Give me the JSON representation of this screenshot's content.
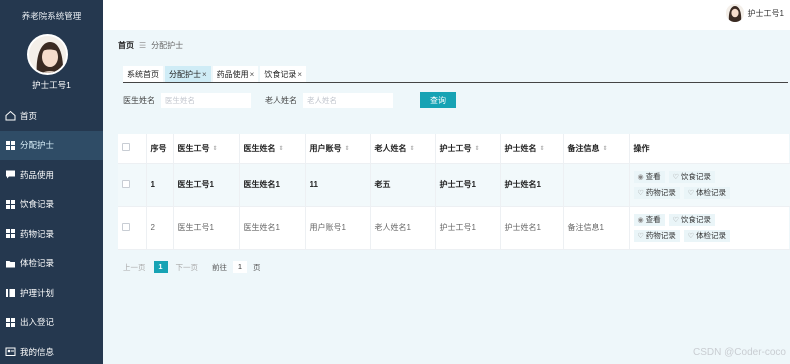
{
  "sidebar": {
    "system_title": "养老院系统管理",
    "user_name": "护士工号1",
    "items": [
      {
        "label": "首页",
        "icon": "home-icon",
        "active": false
      },
      {
        "label": "分配护士",
        "icon": "grid-icon",
        "active": true
      },
      {
        "label": "药品使用",
        "icon": "chat-icon",
        "active": false
      },
      {
        "label": "饮食记录",
        "icon": "grid-icon",
        "active": false
      },
      {
        "label": "药物记录",
        "icon": "grid-icon",
        "active": false
      },
      {
        "label": "体检记录",
        "icon": "folder-icon",
        "active": false
      },
      {
        "label": "护理计划",
        "icon": "bars-icon",
        "active": false
      },
      {
        "label": "出入登记",
        "icon": "grid-icon",
        "active": false
      },
      {
        "label": "我的信息",
        "icon": "user-card-icon",
        "active": false
      }
    ]
  },
  "topbar": {
    "user_name": "护士工号1"
  },
  "breadcrumb": {
    "home": "首页",
    "separator": "☰",
    "current": "分配护士"
  },
  "tabs": [
    {
      "label": "系统首页",
      "closable": false,
      "active": false
    },
    {
      "label": "分配护士",
      "closable": true,
      "active": true
    },
    {
      "label": "药品使用",
      "closable": true,
      "active": false
    },
    {
      "label": "饮食记录",
      "closable": true,
      "active": false
    }
  ],
  "tab_close_glyph": "×",
  "search": {
    "doctor_label": "医生姓名",
    "doctor_placeholder": "医生姓名",
    "elder_label": "老人姓名",
    "elder_placeholder": "老人姓名",
    "query_button": "查询"
  },
  "table": {
    "columns": [
      "序号",
      "医生工号",
      "医生姓名",
      "用户账号",
      "老人姓名",
      "护士工号",
      "护士姓名",
      "备注信息",
      "操作"
    ],
    "sort_glyph": "⇕",
    "rows": [
      {
        "index": "1",
        "doctor_id": "医生工号1",
        "doctor_name": "医生姓名1",
        "user_account": "11",
        "elder_name": "老五",
        "nurse_id": "护士工号1",
        "nurse_name": "护士姓名1",
        "remark": ""
      },
      {
        "index": "2",
        "doctor_id": "医生工号1",
        "doctor_name": "医生姓名1",
        "user_account": "用户账号1",
        "elder_name": "老人姓名1",
        "nurse_id": "护士工号1",
        "nurse_name": "护士姓名1",
        "remark": "备注信息1"
      }
    ],
    "actions": {
      "view": "查看",
      "diet": "饮食记录",
      "medicine": "药物记录",
      "checkup": "体检记录"
    }
  },
  "pagination": {
    "prev": "上一页",
    "current_page": "1",
    "next": "下一页",
    "goto_label": "前往",
    "goto_value": "1",
    "page_unit": "页"
  },
  "watermark": "CSDN @Coder-coco",
  "colors": {
    "sidebar_bg": "#25384f",
    "accent": "#17a3b4",
    "content_bg": "#eef7fa",
    "active_tab": "#cfecf6"
  }
}
